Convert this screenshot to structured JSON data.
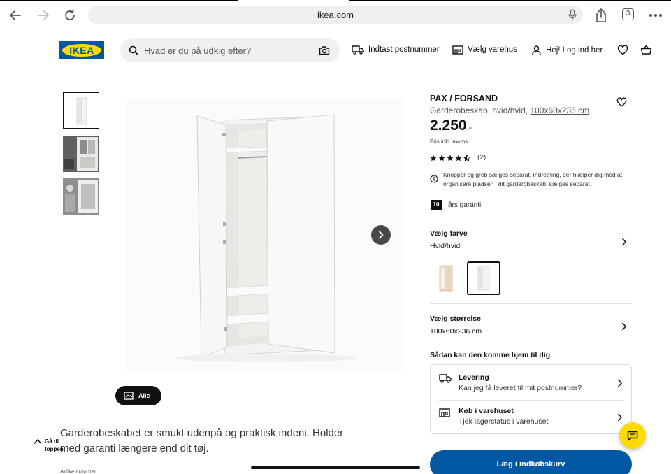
{
  "browser": {
    "url": "ikea.com",
    "tab_count": "3"
  },
  "header": {
    "logo_text": "IKEA",
    "search_placeholder": "Hvad er du på udkig efter?",
    "postcode_label": "Indtast postnummer",
    "store_label": "Vælg varehus",
    "login_label": "Hej! Log ind her"
  },
  "product": {
    "name": "PAX / FORSAND",
    "type": "Garderobeskab, hvid/hvid,",
    "size_link": "100x60x236 cm",
    "price": "2.250",
    "price_suffix": ".-",
    "vat_note": "Pris inkl. moms",
    "rating": 4.5,
    "review_count": "(2)",
    "note": "Knopper og greb sælges separat. Indretning, der hjælper dig med at organisere pladsen i dit garderobeskab, sælges separat.",
    "warranty_years": "10",
    "warranty_label": "års garanti"
  },
  "color_section": {
    "title": "Vælg farve",
    "value": "Hvid/hvid"
  },
  "size_section": {
    "title": "Vælg størrelse",
    "value": "100x60x236 cm"
  },
  "delivery": {
    "title": "Sådan kan den komme hjem til dig",
    "options": [
      {
        "title": "Levering",
        "subtitle": "Kan jeg få leveret til mit postnummer?"
      },
      {
        "title": "Køb i varehuset",
        "subtitle": "Tjek lagerstatus i varehuset"
      }
    ]
  },
  "cart_button": "Læg i indkøbskurv",
  "gallery": {
    "all_label": "Alle"
  },
  "description": "Garderobeskabet er smukt udenpå og praktisk indeni. Holder med garanti længere end dit tøj.",
  "back_to_top": "Gå til toppen",
  "article_number_label": "Artikelnummer",
  "colors": {
    "brand_blue": "#0058a3",
    "brand_yellow": "#ffdb00"
  }
}
